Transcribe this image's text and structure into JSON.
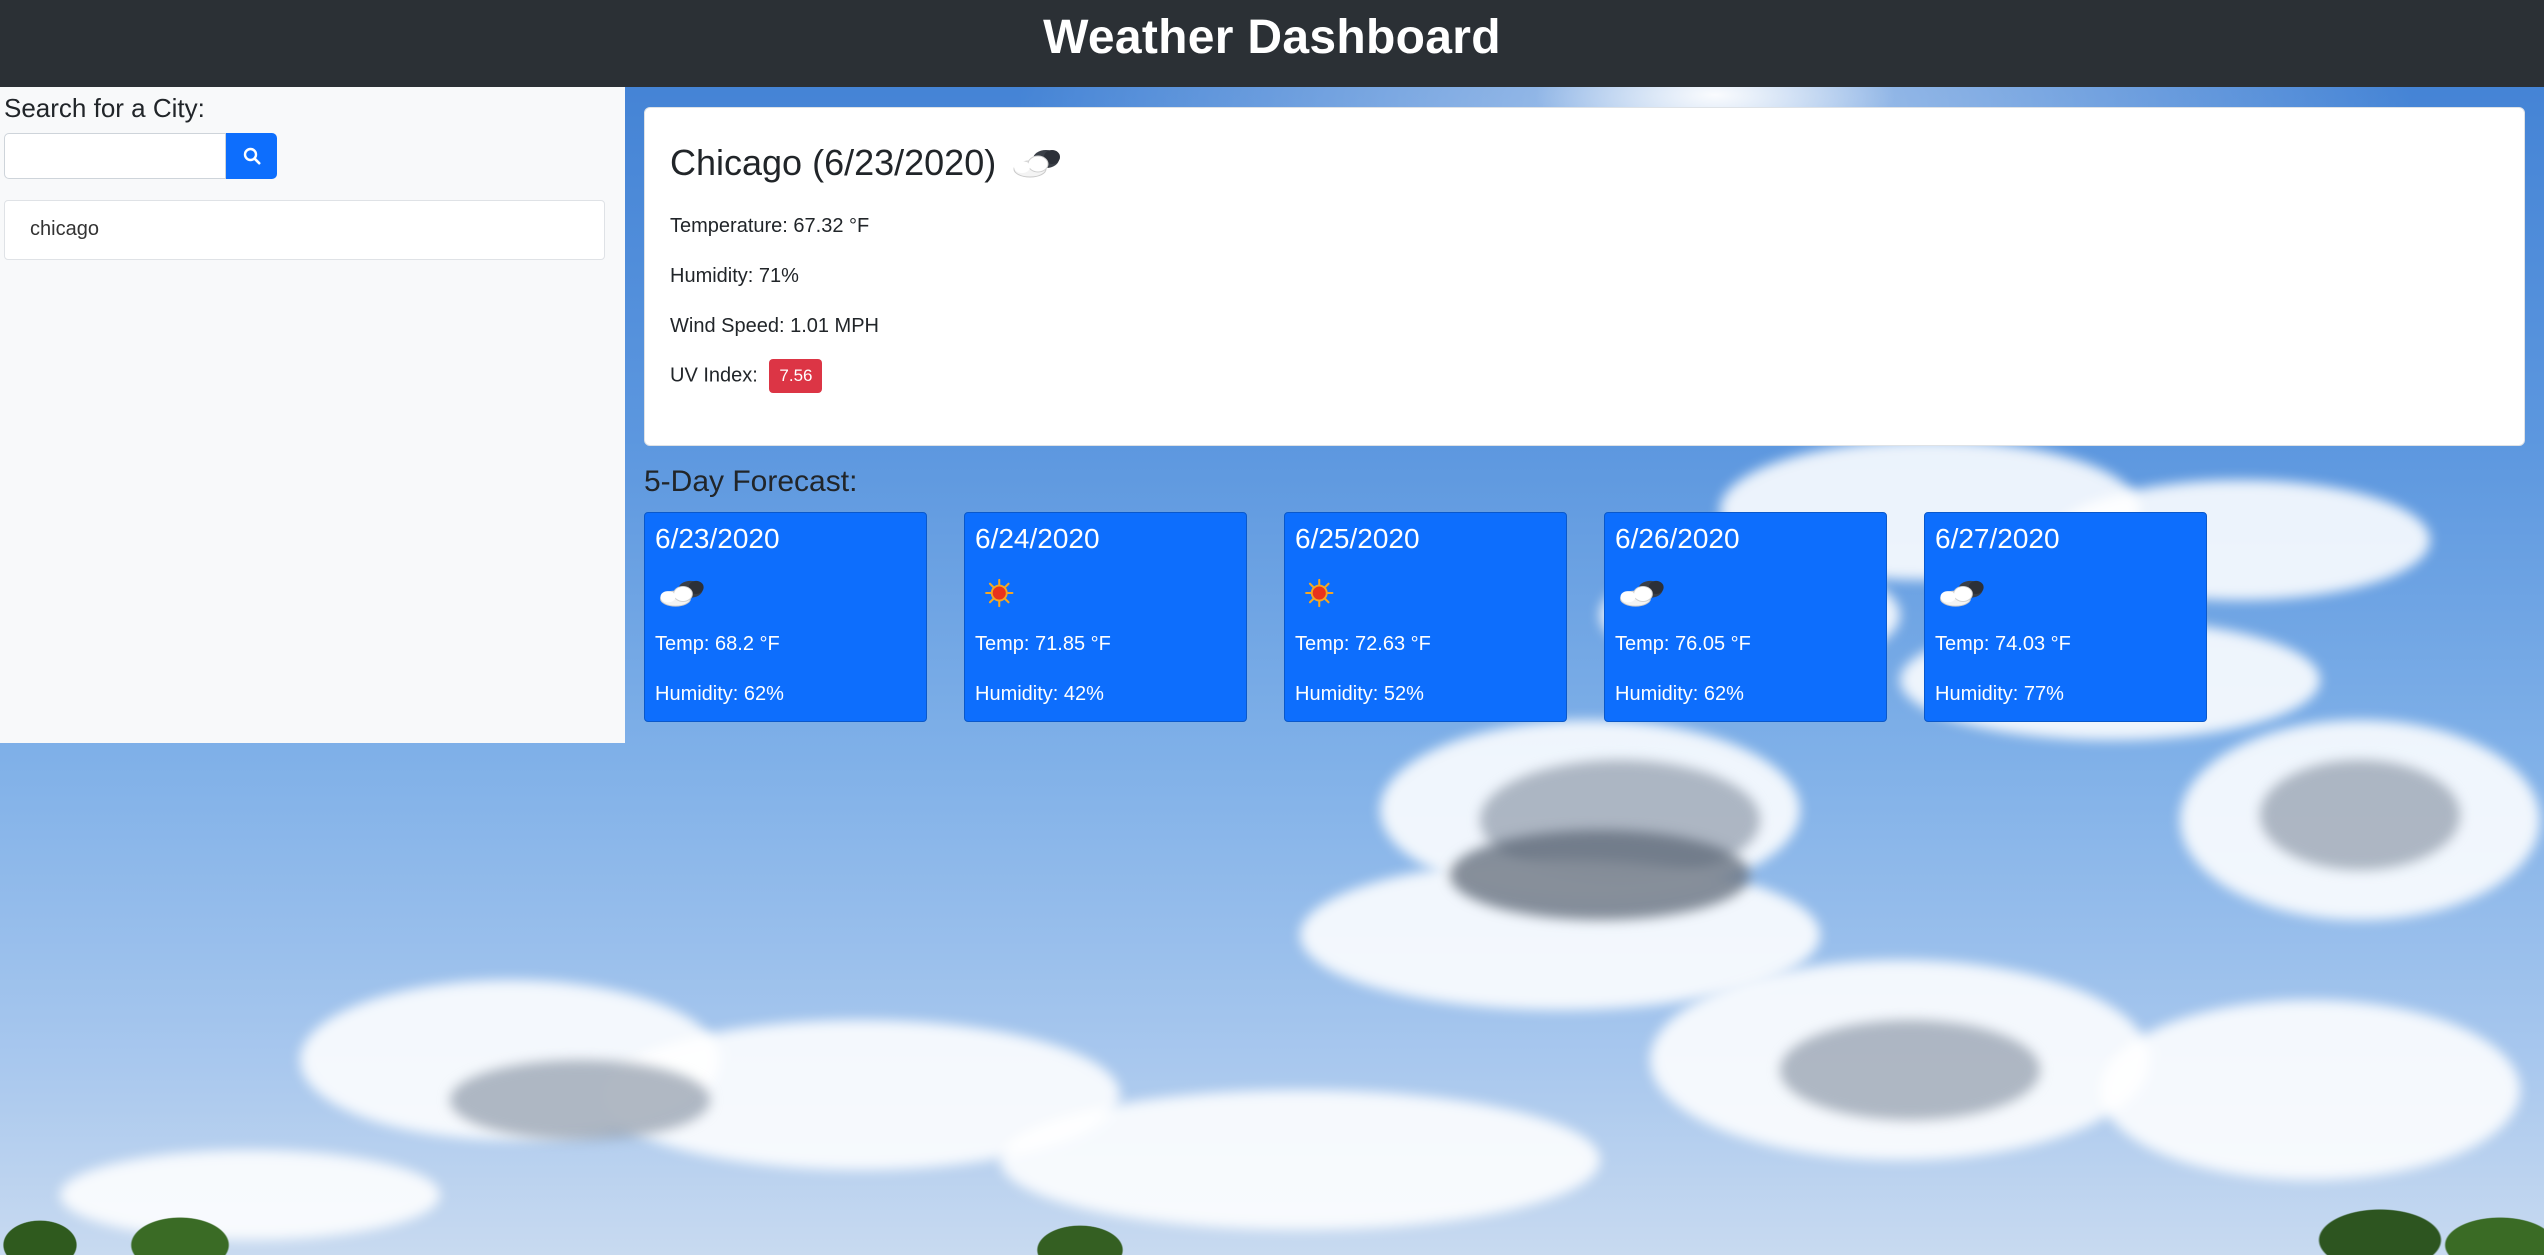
{
  "header": {
    "title": "Weather Dashboard"
  },
  "sidebar": {
    "search_label": "Search for a City:",
    "search_value": "",
    "search_placeholder": "",
    "search_button_icon": "search-icon",
    "history": [
      "chicago"
    ]
  },
  "current": {
    "title": "Chicago (6/23/2020)",
    "icon": "cloudy-night-icon",
    "temperature": "Temperature: 67.32 °F",
    "humidity": "Humidity: 71%",
    "wind": "Wind Speed: 1.01 MPH",
    "uv_label": "UV Index:",
    "uv_value": "7.56",
    "uv_color": "#dc3545"
  },
  "forecast": {
    "title": "5-Day Forecast:",
    "days": [
      {
        "date": "6/23/2020",
        "icon": "cloudy-night-icon",
        "temp": "Temp: 68.2 °F",
        "humidity": "Humidity: 62%"
      },
      {
        "date": "6/24/2020",
        "icon": "sun-icon",
        "temp": "Temp: 71.85 °F",
        "humidity": "Humidity: 42%"
      },
      {
        "date": "6/25/2020",
        "icon": "sun-icon",
        "temp": "Temp: 72.63 °F",
        "humidity": "Humidity: 52%"
      },
      {
        "date": "6/26/2020",
        "icon": "cloudy-night-icon",
        "temp": "Temp: 76.05 °F",
        "humidity": "Humidity: 62%"
      },
      {
        "date": "6/27/2020",
        "icon": "cloudy-night-icon",
        "temp": "Temp: 74.03 °F",
        "humidity": "Humidity: 77%"
      }
    ]
  },
  "colors": {
    "header_bg": "#2b3035",
    "primary": "#0d6efd",
    "danger": "#dc3545",
    "sidebar_bg": "#f8f9fa"
  }
}
